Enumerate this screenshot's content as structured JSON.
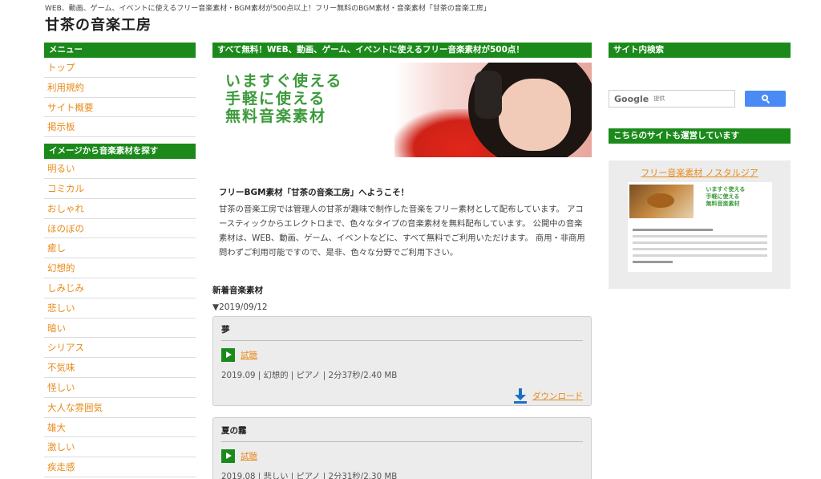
{
  "header": {
    "description": "WEB、動画、ゲーム、イベントに使えるフリー音楽素材・BGM素材が500点以上！フリー無料のBGM素材・音楽素材「甘茶の音楽工房」",
    "title": "甘茶の音楽工房"
  },
  "left": {
    "menu_heading": "メニュー",
    "menu": [
      "トップ",
      "利用規約",
      "サイト概要",
      "掲示板"
    ],
    "image_heading": "イメージから音楽素材を探す",
    "images": [
      "明るい",
      "コミカル",
      "おしゃれ",
      "ほのぼの",
      "癒し",
      "幻想的",
      "しみじみ",
      "悲しい",
      "暗い",
      "シリアス",
      "不気味",
      "怪しい",
      "大人な雰囲気",
      "雄大",
      "激しい",
      "疾走感"
    ]
  },
  "main": {
    "banner_heading": "すべて無料！WEB、動画、ゲーム、イベントに使えるフリー音楽素材が500点！",
    "hero_lines": [
      "いますぐ使える",
      "手軽に使える",
      "無料音楽素材"
    ],
    "intro_title": "フリーBGM素材「甘茶の音楽工房」へようこそ！",
    "intro_body": "甘茶の音楽工房では管理人の甘茶が趣味で制作した音楽をフリー素材として配布しています。 アコースティックからエレクトロまで、色々なタイプの音楽素材を無料配布しています。 公開中の音楽素材は、WEB、動画、ゲーム、イベントなどに、すべて無料でご利用いただけます。 商用・非商用問わずご利用可能ですので、是非、色々な分野でご利用下さい。",
    "new_heading": "新着音楽素材",
    "date": "▼2019/09/12",
    "tracks": [
      {
        "name": "夢",
        "listen": "試聴",
        "meta": "2019.09 | 幻想的 | ピアノ | 2分37秒/2.40 MB",
        "download": "ダウンロード"
      },
      {
        "name": "夏の霧",
        "listen": "試聴",
        "meta": "2019.08 | 悲しい | ピアノ | 2分31秒/2.30 MB"
      }
    ]
  },
  "right": {
    "search_heading": "サイト内検索",
    "search_logo": "Google",
    "search_provided": "提供",
    "other_heading": "こちらのサイトも運営しています",
    "promo_link": "フリー音楽素材 ノスタルジア",
    "promo_lines": [
      "いますぐ使える",
      "手軽に使える",
      "無料音楽素材"
    ]
  },
  "colors": {
    "green": "#1b8a1b",
    "link_orange": "#e88a1a",
    "download_blue": "#1c6fc4"
  }
}
